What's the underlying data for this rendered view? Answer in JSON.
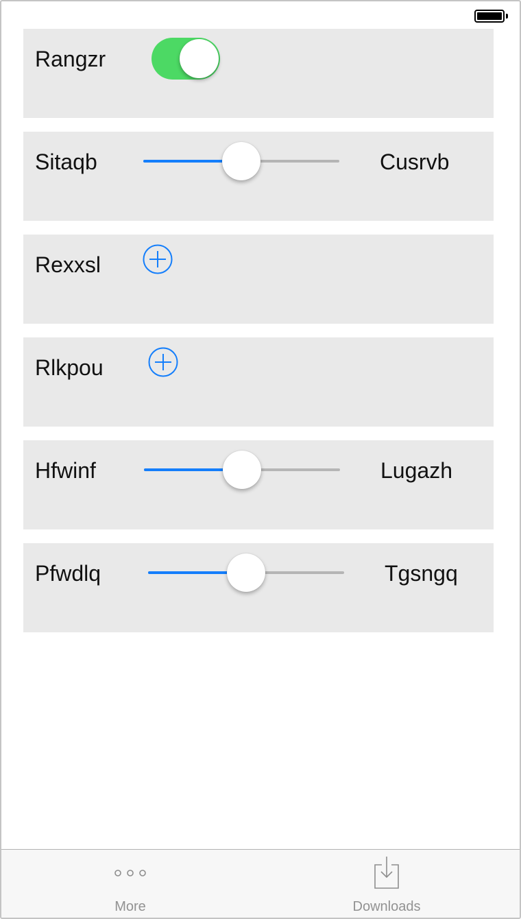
{
  "status_bar": {
    "battery_icon": "battery-full-icon"
  },
  "rows": [
    {
      "type": "toggle",
      "label": "Rangzr",
      "value": true
    },
    {
      "type": "slider",
      "label": "Sitaqb",
      "right_label": "Cusrvb",
      "value": 0.5
    },
    {
      "type": "add",
      "label": "Rexxsl",
      "icon": "plus-circle-icon"
    },
    {
      "type": "add",
      "label": "Rlkpou",
      "icon": "plus-circle-icon"
    },
    {
      "type": "slider",
      "label": "Hfwinf",
      "right_label": "Lugazh",
      "value": 0.5
    },
    {
      "type": "slider",
      "label": "Pfwdlq",
      "right_label": "Tgsngq",
      "value": 0.5
    }
  ],
  "tabbar": {
    "tabs": [
      {
        "label": "More",
        "icon": "more-dots-icon"
      },
      {
        "label": "Downloads",
        "icon": "download-tray-icon"
      }
    ]
  },
  "colors": {
    "accent": "#147efb",
    "toggle_on": "#4cd964",
    "card_bg": "#e9e9e9",
    "tab_inactive": "#929292"
  }
}
